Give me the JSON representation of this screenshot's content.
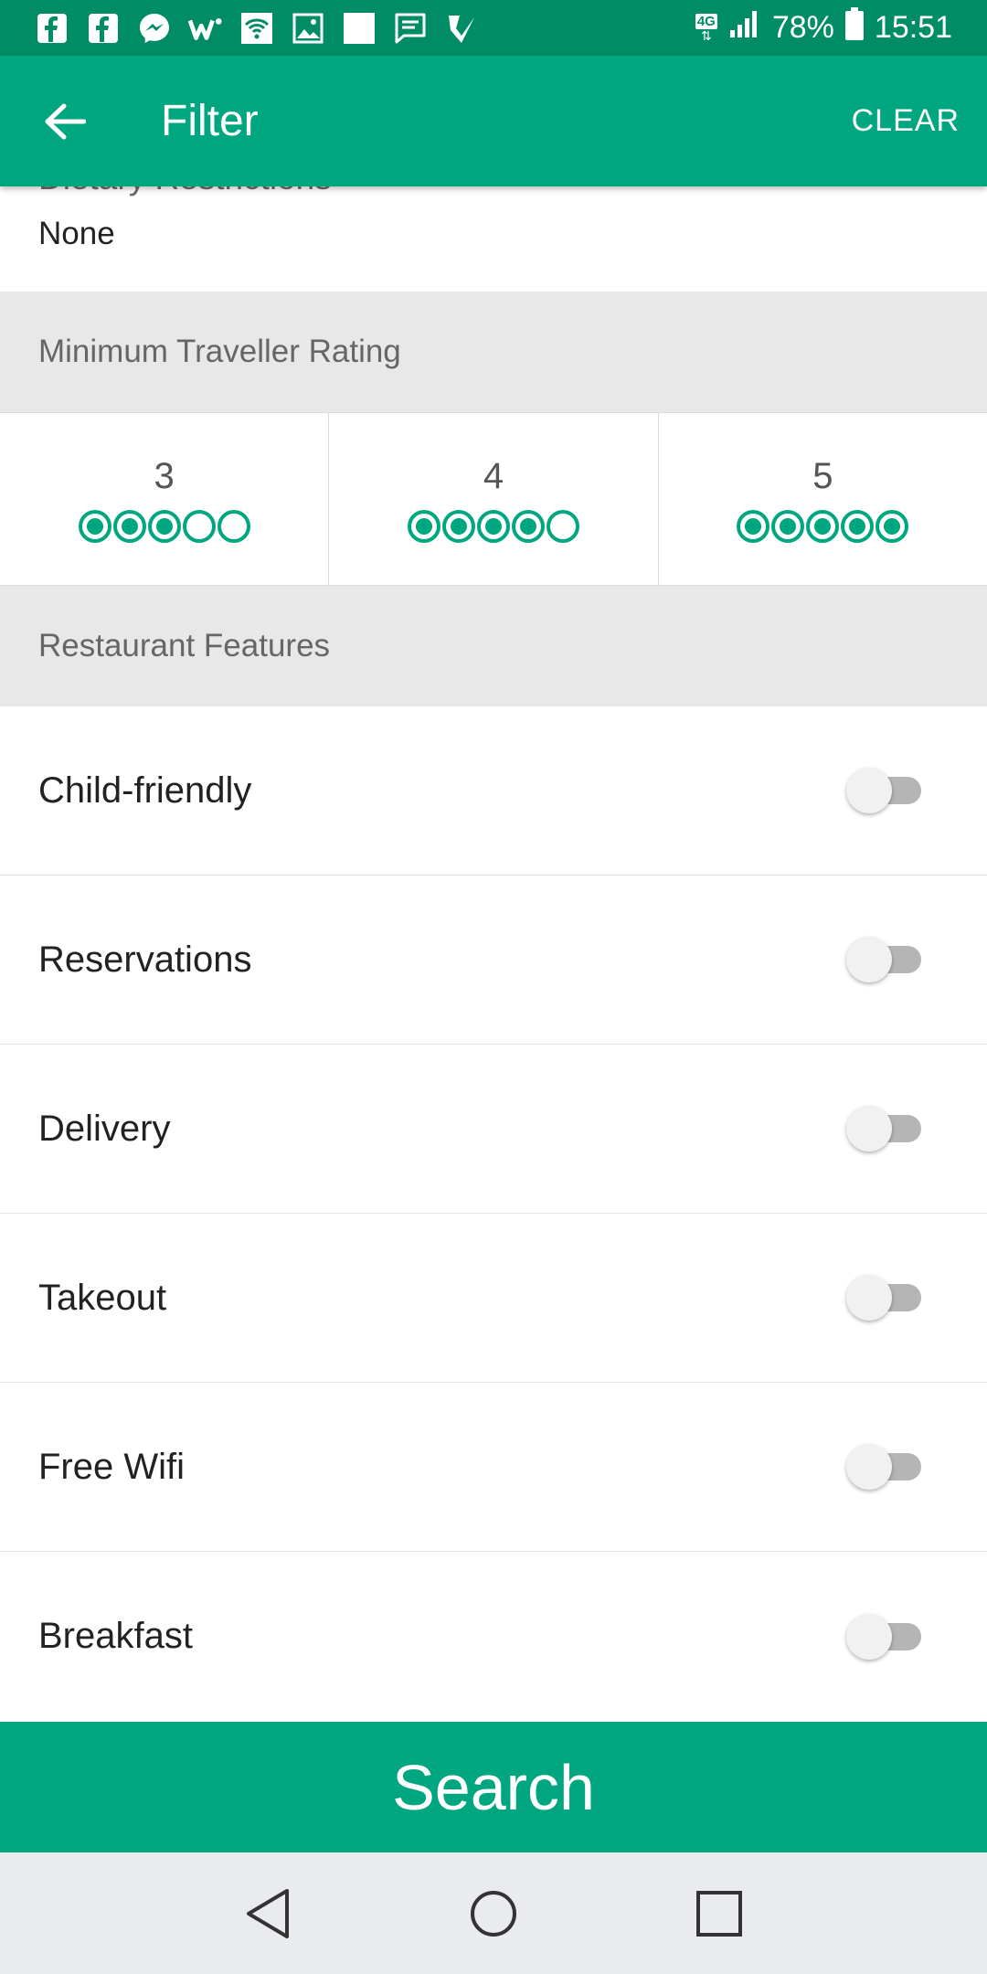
{
  "status_bar": {
    "network": "4G",
    "battery": "78%",
    "time": "15:51",
    "notification_icons": [
      "facebook-icon",
      "facebook-icon",
      "messenger-icon",
      "w-app-icon",
      "wifi-call-icon",
      "gallery-icon",
      "blank-square-icon",
      "message-icon",
      "checkmark-app-icon"
    ]
  },
  "app_bar": {
    "title": "Filter",
    "clear_label": "CLEAR"
  },
  "dietary": {
    "label": "Dietary Restrictions",
    "value": "None"
  },
  "rating_section": {
    "header": "Minimum Traveller Rating",
    "options": [
      {
        "label": "3",
        "filled": 3
      },
      {
        "label": "4",
        "filled": 4
      },
      {
        "label": "5",
        "filled": 5
      }
    ]
  },
  "features_section": {
    "header": "Restaurant Features",
    "items": [
      {
        "label": "Child-friendly",
        "on": false
      },
      {
        "label": "Reservations",
        "on": false
      },
      {
        "label": "Delivery",
        "on": false
      },
      {
        "label": "Takeout",
        "on": false
      },
      {
        "label": "Free Wifi",
        "on": false
      },
      {
        "label": "Breakfast",
        "on": false
      }
    ]
  },
  "search_button": {
    "label": "Search"
  },
  "colors": {
    "status_bar": "#008c64",
    "app_bar": "#00a680",
    "accent": "#00a680",
    "section_bg": "#e8e8e8",
    "nav_bar": "#e9ebee"
  },
  "nav": [
    "back-triangle-icon",
    "home-circle-icon",
    "recents-square-icon"
  ]
}
